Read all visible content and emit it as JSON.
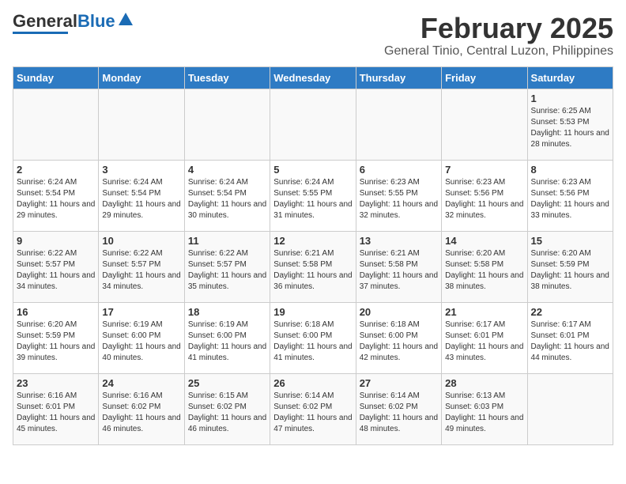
{
  "header": {
    "logo_general": "General",
    "logo_blue": "Blue",
    "month_title": "February 2025",
    "location": "General Tinio, Central Luzon, Philippines"
  },
  "days_of_week": [
    "Sunday",
    "Monday",
    "Tuesday",
    "Wednesday",
    "Thursday",
    "Friday",
    "Saturday"
  ],
  "weeks": [
    [
      {
        "day": "",
        "info": ""
      },
      {
        "day": "",
        "info": ""
      },
      {
        "day": "",
        "info": ""
      },
      {
        "day": "",
        "info": ""
      },
      {
        "day": "",
        "info": ""
      },
      {
        "day": "",
        "info": ""
      },
      {
        "day": "1",
        "info": "Sunrise: 6:25 AM\nSunset: 5:53 PM\nDaylight: 11 hours and 28 minutes."
      }
    ],
    [
      {
        "day": "2",
        "info": "Sunrise: 6:24 AM\nSunset: 5:54 PM\nDaylight: 11 hours and 29 minutes."
      },
      {
        "day": "3",
        "info": "Sunrise: 6:24 AM\nSunset: 5:54 PM\nDaylight: 11 hours and 29 minutes."
      },
      {
        "day": "4",
        "info": "Sunrise: 6:24 AM\nSunset: 5:54 PM\nDaylight: 11 hours and 30 minutes."
      },
      {
        "day": "5",
        "info": "Sunrise: 6:24 AM\nSunset: 5:55 PM\nDaylight: 11 hours and 31 minutes."
      },
      {
        "day": "6",
        "info": "Sunrise: 6:23 AM\nSunset: 5:55 PM\nDaylight: 11 hours and 32 minutes."
      },
      {
        "day": "7",
        "info": "Sunrise: 6:23 AM\nSunset: 5:56 PM\nDaylight: 11 hours and 32 minutes."
      },
      {
        "day": "8",
        "info": "Sunrise: 6:23 AM\nSunset: 5:56 PM\nDaylight: 11 hours and 33 minutes."
      }
    ],
    [
      {
        "day": "9",
        "info": "Sunrise: 6:22 AM\nSunset: 5:57 PM\nDaylight: 11 hours and 34 minutes."
      },
      {
        "day": "10",
        "info": "Sunrise: 6:22 AM\nSunset: 5:57 PM\nDaylight: 11 hours and 34 minutes."
      },
      {
        "day": "11",
        "info": "Sunrise: 6:22 AM\nSunset: 5:57 PM\nDaylight: 11 hours and 35 minutes."
      },
      {
        "day": "12",
        "info": "Sunrise: 6:21 AM\nSunset: 5:58 PM\nDaylight: 11 hours and 36 minutes."
      },
      {
        "day": "13",
        "info": "Sunrise: 6:21 AM\nSunset: 5:58 PM\nDaylight: 11 hours and 37 minutes."
      },
      {
        "day": "14",
        "info": "Sunrise: 6:20 AM\nSunset: 5:58 PM\nDaylight: 11 hours and 38 minutes."
      },
      {
        "day": "15",
        "info": "Sunrise: 6:20 AM\nSunset: 5:59 PM\nDaylight: 11 hours and 38 minutes."
      }
    ],
    [
      {
        "day": "16",
        "info": "Sunrise: 6:20 AM\nSunset: 5:59 PM\nDaylight: 11 hours and 39 minutes."
      },
      {
        "day": "17",
        "info": "Sunrise: 6:19 AM\nSunset: 6:00 PM\nDaylight: 11 hours and 40 minutes."
      },
      {
        "day": "18",
        "info": "Sunrise: 6:19 AM\nSunset: 6:00 PM\nDaylight: 11 hours and 41 minutes."
      },
      {
        "day": "19",
        "info": "Sunrise: 6:18 AM\nSunset: 6:00 PM\nDaylight: 11 hours and 41 minutes."
      },
      {
        "day": "20",
        "info": "Sunrise: 6:18 AM\nSunset: 6:00 PM\nDaylight: 11 hours and 42 minutes."
      },
      {
        "day": "21",
        "info": "Sunrise: 6:17 AM\nSunset: 6:01 PM\nDaylight: 11 hours and 43 minutes."
      },
      {
        "day": "22",
        "info": "Sunrise: 6:17 AM\nSunset: 6:01 PM\nDaylight: 11 hours and 44 minutes."
      }
    ],
    [
      {
        "day": "23",
        "info": "Sunrise: 6:16 AM\nSunset: 6:01 PM\nDaylight: 11 hours and 45 minutes."
      },
      {
        "day": "24",
        "info": "Sunrise: 6:16 AM\nSunset: 6:02 PM\nDaylight: 11 hours and 46 minutes."
      },
      {
        "day": "25",
        "info": "Sunrise: 6:15 AM\nSunset: 6:02 PM\nDaylight: 11 hours and 46 minutes."
      },
      {
        "day": "26",
        "info": "Sunrise: 6:14 AM\nSunset: 6:02 PM\nDaylight: 11 hours and 47 minutes."
      },
      {
        "day": "27",
        "info": "Sunrise: 6:14 AM\nSunset: 6:02 PM\nDaylight: 11 hours and 48 minutes."
      },
      {
        "day": "28",
        "info": "Sunrise: 6:13 AM\nSunset: 6:03 PM\nDaylight: 11 hours and 49 minutes."
      },
      {
        "day": "",
        "info": ""
      }
    ]
  ]
}
